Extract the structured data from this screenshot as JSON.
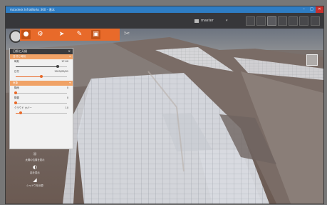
{
  "window": {
    "title": "Autodesk InfraWorks 360 – 基本",
    "controls": [
      "–",
      "□",
      "✕"
    ]
  },
  "toolbar": {
    "project_label": "master",
    "project_dropdown": "▾"
  },
  "panel": {
    "title": "日照と天候",
    "close": "✕",
    "sections": [
      {
        "label": "日付と時刻",
        "rows": [
          {
            "label": "時刻",
            "value": "17:00",
            "slider": 0.82
          },
          {
            "label": "日付",
            "value": "2015/09/01",
            "slider": 0.5
          }
        ]
      },
      {
        "label": "気象",
        "rows": [
          {
            "label": "降雨",
            "value": "0",
            "slider": 0.0
          },
          {
            "label": "降雪",
            "value": "0",
            "slider": 0.0
          },
          {
            "label": "クラウド カバー",
            "value": "10",
            "slider": 0.1
          }
        ]
      }
    ]
  },
  "left_buttons": [
    {
      "label": "太陽の位置を表示",
      "icon": "sun-position-icon"
    },
    {
      "label": "影を表示",
      "icon": "shadow-icon"
    },
    {
      "label": "シャドウを計算",
      "icon": "shadow-calc-icon"
    }
  ],
  "colors": {
    "accent": "#e86a2a",
    "titlebar": "#2e7dc4",
    "toolbar": "#37373a"
  }
}
